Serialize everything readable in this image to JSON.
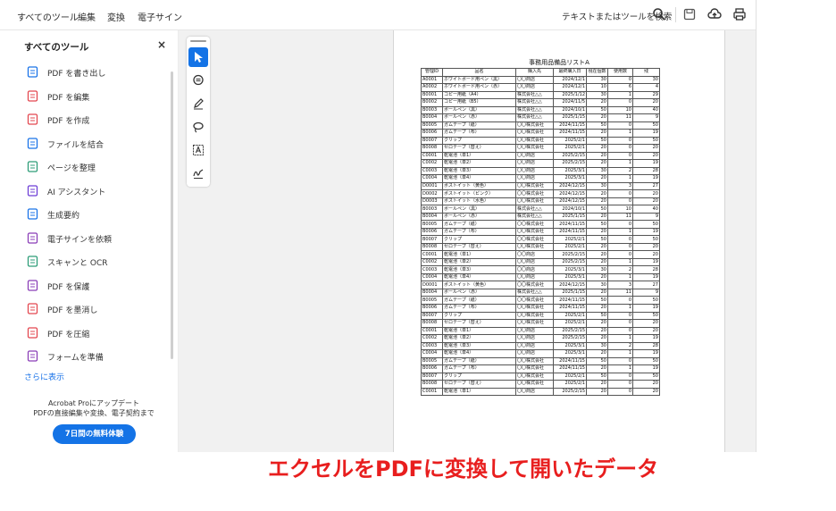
{
  "menu": [
    "すべてのツール",
    "編集",
    "変換",
    "電子サイン"
  ],
  "search_label": "テキストまたはツールを検索",
  "sidebar": {
    "title": "すべてのツール",
    "close": "×",
    "tools": [
      {
        "label": "PDF を書き出し",
        "icon": "export-pdf-icon",
        "color": "#1a73e8"
      },
      {
        "label": "PDF を編集",
        "icon": "edit-pdf-icon",
        "color": "#e34850"
      },
      {
        "label": "PDF を作成",
        "icon": "create-pdf-icon",
        "color": "#e34850"
      },
      {
        "label": "ファイルを結合",
        "icon": "combine-files-icon",
        "color": "#1a73e8"
      },
      {
        "label": "ページを整理",
        "icon": "organize-pages-icon",
        "color": "#2d9d78"
      },
      {
        "label": "AI アシスタント",
        "icon": "ai-assistant-icon",
        "color": "#6e3fd6"
      },
      {
        "label": "生成要約",
        "icon": "generative-summary-icon",
        "color": "#1a73e8"
      },
      {
        "label": "電子サインを依頼",
        "icon": "request-esign-icon",
        "color": "#8b3fb8"
      },
      {
        "label": "スキャンと OCR",
        "icon": "scan-ocr-icon",
        "color": "#2d9d78"
      },
      {
        "label": "PDF を保護",
        "icon": "protect-pdf-icon",
        "color": "#8b3fb8"
      },
      {
        "label": "PDF を墨消し",
        "icon": "redact-pdf-icon",
        "color": "#e34850"
      },
      {
        "label": "PDF を圧縮",
        "icon": "compress-pdf-icon",
        "color": "#e34850"
      },
      {
        "label": "フォームを準備",
        "icon": "prepare-form-icon",
        "color": "#8b3fb8"
      }
    ],
    "more": "さらに表示",
    "promo_line1": "Acrobat Proにアップデート",
    "promo_line2": "PDFの直接編集や変換、電子契約まで",
    "trial_button": "7日間の無料体験"
  },
  "document": {
    "title": "事務用品備品リストA",
    "headers": [
      "管理ID",
      "品名",
      "購入先",
      "最終購入日",
      "現在個数",
      "使用数",
      "残"
    ],
    "rows": [
      [
        "A0001",
        "ホワイトボード用ペン（黒）",
        "〇〇商店",
        "2024/12/1",
        "30",
        "0",
        "30"
      ],
      [
        "A0002",
        "ホワイトボード用ペン（赤）",
        "〇〇商店",
        "2024/12/1",
        "10",
        "6",
        "4"
      ],
      [
        "B0001",
        "コピー用紙（A4）",
        "株式会社△△",
        "2025/1/12",
        "30",
        "1",
        "29"
      ],
      [
        "B0002",
        "コピー用紙（B5）",
        "株式会社△△",
        "2024/11/5",
        "20",
        "0",
        "20"
      ],
      [
        "B0003",
        "ボールペン（黒）",
        "株式会社△△",
        "2024/10/1",
        "50",
        "10",
        "40"
      ],
      [
        "B0004",
        "ボールペン（赤）",
        "株式会社△△",
        "2025/1/15",
        "20",
        "11",
        "9"
      ],
      [
        "B0005",
        "ガムテープ（紙）",
        "〇〇株式会社",
        "2024/11/15",
        "50",
        "0",
        "50"
      ],
      [
        "B0006",
        "ガムテープ（布）",
        "〇〇株式会社",
        "2024/11/15",
        "20",
        "1",
        "19"
      ],
      [
        "B0007",
        "クリップ",
        "〇〇株式会社",
        "2025/2/1",
        "50",
        "0",
        "50"
      ],
      [
        "B0008",
        "セロテープ（替え）",
        "〇〇株式会社",
        "2025/2/1",
        "20",
        "0",
        "20"
      ],
      [
        "C0001",
        "乾電池（単1）",
        "〇〇商店",
        "2025/2/15",
        "20",
        "0",
        "20"
      ],
      [
        "C0002",
        "乾電池（単2）",
        "〇〇商店",
        "2025/2/15",
        "20",
        "1",
        "19"
      ],
      [
        "C0003",
        "乾電池（単3）",
        "〇〇商店",
        "2025/3/1",
        "30",
        "2",
        "28"
      ],
      [
        "C0004",
        "乾電池（単4）",
        "〇〇商店",
        "2025/3/1",
        "20",
        "1",
        "19"
      ],
      [
        "D0001",
        "ポストイット（黄色）",
        "〇〇株式会社",
        "2024/12/15",
        "30",
        "3",
        "27"
      ],
      [
        "D0002",
        "ポストイット（ピンク）",
        "〇〇株式会社",
        "2024/12/15",
        "20",
        "0",
        "20"
      ],
      [
        "D0003",
        "ポストイット（水色）",
        "〇〇株式会社",
        "2024/12/15",
        "20",
        "0",
        "20"
      ],
      [
        "B0003",
        "ボールペン（黒）",
        "株式会社△△",
        "2024/10/1",
        "50",
        "10",
        "40"
      ],
      [
        "B0004",
        "ボールペン（赤）",
        "株式会社△△",
        "2025/1/15",
        "20",
        "11",
        "9"
      ],
      [
        "B0005",
        "ガムテープ（紙）",
        "〇〇株式会社",
        "2024/11/15",
        "50",
        "0",
        "50"
      ],
      [
        "B0006",
        "ガムテープ（布）",
        "〇〇株式会社",
        "2024/11/15",
        "20",
        "1",
        "19"
      ],
      [
        "B0007",
        "クリップ",
        "〇〇株式会社",
        "2025/2/1",
        "50",
        "0",
        "50"
      ],
      [
        "B0008",
        "セロテープ（替え）",
        "〇〇株式会社",
        "2025/2/1",
        "20",
        "0",
        "20"
      ],
      [
        "C0001",
        "乾電池（単1）",
        "〇〇商店",
        "2025/2/15",
        "20",
        "0",
        "20"
      ],
      [
        "C0002",
        "乾電池（単2）",
        "〇〇商店",
        "2025/2/15",
        "20",
        "1",
        "19"
      ],
      [
        "C0003",
        "乾電池（単3）",
        "〇〇商店",
        "2025/3/1",
        "30",
        "2",
        "28"
      ],
      [
        "C0004",
        "乾電池（単4）",
        "〇〇商店",
        "2025/3/1",
        "20",
        "1",
        "19"
      ],
      [
        "D0001",
        "ポストイット（黄色）",
        "〇〇株式会社",
        "2024/12/15",
        "30",
        "3",
        "27"
      ],
      [
        "B0004",
        "ボールペン（赤）",
        "株式会社△△",
        "2025/1/15",
        "20",
        "11",
        "9"
      ],
      [
        "B0005",
        "ガムテープ（紙）",
        "〇〇株式会社",
        "2024/11/15",
        "50",
        "0",
        "50"
      ],
      [
        "B0006",
        "ガムテープ（布）",
        "〇〇株式会社",
        "2024/11/15",
        "20",
        "1",
        "19"
      ],
      [
        "B0007",
        "クリップ",
        "〇〇株式会社",
        "2025/2/1",
        "50",
        "0",
        "50"
      ],
      [
        "B0008",
        "セロテープ（替え）",
        "〇〇株式会社",
        "2025/2/1",
        "20",
        "0",
        "20"
      ],
      [
        "C0001",
        "乾電池（単1）",
        "〇〇商店",
        "2025/2/15",
        "20",
        "0",
        "20"
      ],
      [
        "C0002",
        "乾電池（単2）",
        "〇〇商店",
        "2025/2/15",
        "20",
        "1",
        "19"
      ],
      [
        "C0003",
        "乾電池（単3）",
        "〇〇商店",
        "2025/3/1",
        "30",
        "2",
        "28"
      ],
      [
        "C0004",
        "乾電池（単4）",
        "〇〇商店",
        "2025/3/1",
        "20",
        "1",
        "19"
      ],
      [
        "B0005",
        "ガムテープ（紙）",
        "〇〇株式会社",
        "2024/11/15",
        "50",
        "0",
        "50"
      ],
      [
        "B0006",
        "ガムテープ（布）",
        "〇〇株式会社",
        "2024/11/15",
        "20",
        "1",
        "19"
      ],
      [
        "B0007",
        "クリップ",
        "〇〇株式会社",
        "2025/2/1",
        "50",
        "0",
        "50"
      ],
      [
        "B0008",
        "セロテープ（替え）",
        "〇〇株式会社",
        "2025/2/1",
        "20",
        "0",
        "20"
      ],
      [
        "C0001",
        "乾電池（単1）",
        "〇〇商店",
        "2025/2/15",
        "20",
        "0",
        "20"
      ]
    ]
  },
  "caption": "エクセルをPDFに変換して開いたデータ",
  "colors": {
    "accent": "#1473e6",
    "caption": "#e81e1e",
    "selected_tool": "#1473e6"
  }
}
